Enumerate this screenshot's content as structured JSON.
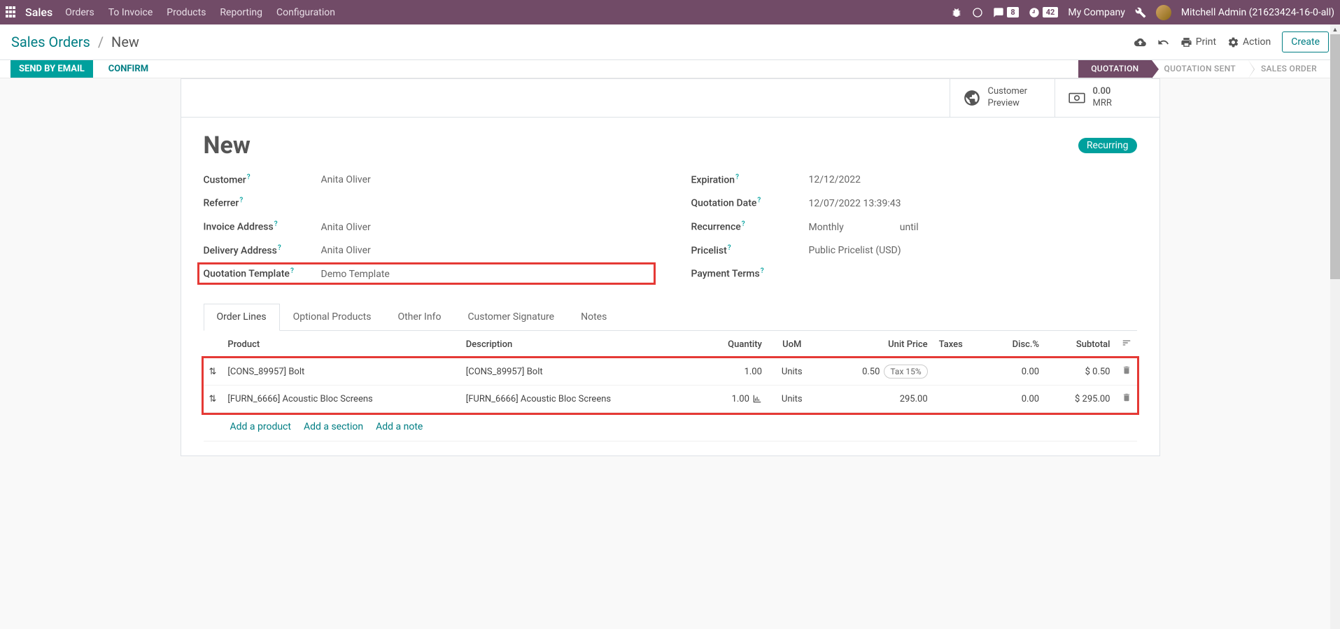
{
  "topbar": {
    "app_name": "Sales",
    "menu": [
      "Orders",
      "To Invoice",
      "Products",
      "Reporting",
      "Configuration"
    ],
    "messaging_badge": "8",
    "activities_badge": "42",
    "company": "My Company",
    "user": "Mitchell Admin (21623424-16-0-all)"
  },
  "breadcrumb": {
    "root": "Sales Orders",
    "current": "New"
  },
  "control": {
    "print": "Print",
    "action": "Action",
    "create": "Create"
  },
  "buttons": {
    "send_by_email": "SEND BY EMAIL",
    "confirm": "CONFIRM"
  },
  "status_steps": [
    "QUOTATION",
    "QUOTATION SENT",
    "SALES ORDER"
  ],
  "stat_buttons": {
    "preview_l1": "Customer",
    "preview_l2": "Preview",
    "mrr_value": "0.00",
    "mrr_label": "MRR"
  },
  "form": {
    "title": "New",
    "tag": "Recurring",
    "customer_label": "Customer",
    "customer": "Anita Oliver",
    "referrer_label": "Referrer",
    "referrer": "",
    "invoice_addr_label": "Invoice Address",
    "invoice_addr": "Anita Oliver",
    "delivery_addr_label": "Delivery Address",
    "delivery_addr": "Anita Oliver",
    "template_label": "Quotation Template",
    "template": "Demo Template",
    "expiration_label": "Expiration",
    "expiration": "12/12/2022",
    "quot_date_label": "Quotation Date",
    "quot_date": "12/07/2022 13:39:43",
    "recurrence_label": "Recurrence",
    "recurrence": "Monthly",
    "recurrence_until": "until",
    "pricelist_label": "Pricelist",
    "pricelist": "Public Pricelist (USD)",
    "payment_terms_label": "Payment Terms",
    "payment_terms": ""
  },
  "tabs": [
    "Order Lines",
    "Optional Products",
    "Other Info",
    "Customer Signature",
    "Notes"
  ],
  "table": {
    "headers": {
      "product": "Product",
      "description": "Description",
      "quantity": "Quantity",
      "uom": "UoM",
      "unit_price": "Unit Price",
      "taxes": "Taxes",
      "disc": "Disc.%",
      "subtotal": "Subtotal"
    },
    "rows": [
      {
        "product": "[CONS_89957] Bolt",
        "description": "[CONS_89957] Bolt",
        "quantity": "1.00",
        "uom": "Units",
        "unit_price": "0.50",
        "taxes": "Tax 15%",
        "disc": "0.00",
        "subtotal": "$ 0.50",
        "show_chart": false
      },
      {
        "product": "[FURN_6666] Acoustic Bloc Screens",
        "description": "[FURN_6666] Acoustic Bloc Screens",
        "quantity": "1.00",
        "uom": "Units",
        "unit_price": "295.00",
        "taxes": "",
        "disc": "0.00",
        "subtotal": "$ 295.00",
        "show_chart": true
      }
    ],
    "add_product": "Add a product",
    "add_section": "Add a section",
    "add_note": "Add a note"
  }
}
